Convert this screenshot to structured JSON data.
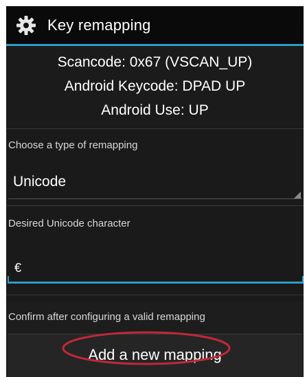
{
  "window": {
    "title": "Key remapping",
    "title_icon": "gear-icon"
  },
  "key_info": {
    "scancode": "Scancode: 0x67 (VSCAN_UP)",
    "android_keycode": "Android Keycode: DPAD UP",
    "android_use": "Android Use: UP"
  },
  "remap_type": {
    "label": "Choose a type of remapping",
    "selected": "Unicode"
  },
  "unicode_char": {
    "label": "Desired Unicode character",
    "value": "€"
  },
  "confirm": {
    "hint": "Confirm after configuring a valid remapping",
    "button_label": "Add a new mapping"
  },
  "colors": {
    "accent": "#2e9cc4",
    "highlight_ellipse": "#c0283a",
    "background": "#1a1a1a",
    "titlebar": "#0a0a0a"
  }
}
